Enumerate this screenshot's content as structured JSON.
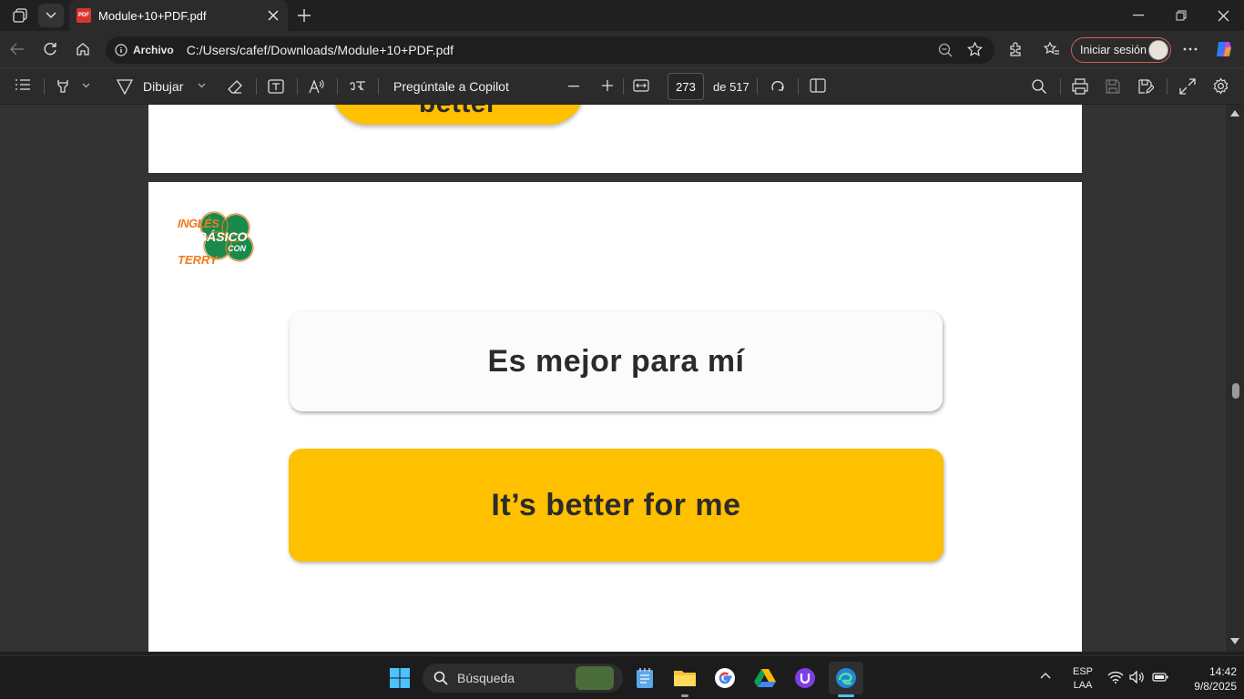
{
  "browser": {
    "tab_title": "Module+10+PDF.pdf",
    "tab_badge": "PDF",
    "address_label": "Archivo",
    "address_path": "C:/Users/cafef/Downloads/Module+10+PDF.pdf",
    "signin_label": "Iniciar sesión"
  },
  "pdf_toolbar": {
    "draw_label": "Dibujar",
    "copilot_label": "Pregúntale a Copilot",
    "current_page": "273",
    "total_pages": "de 517"
  },
  "document": {
    "prev_card_text": "better",
    "logo": {
      "line1": "INGLÉS",
      "line2": "BÁSICO",
      "line3": "CON",
      "line4": "TERRY"
    },
    "spanish_phrase": "Es mejor para mí",
    "english_phrase": "It’s better for me"
  },
  "taskbar": {
    "search_placeholder": "Búsqueda",
    "lang_top": "ESP",
    "lang_bottom": "LAA",
    "time": "14:42",
    "date": "9/8/2025"
  },
  "colors": {
    "accent_yellow": "#ffc000",
    "logo_green": "#1a8a4c",
    "logo_orange": "#f07a1c"
  }
}
